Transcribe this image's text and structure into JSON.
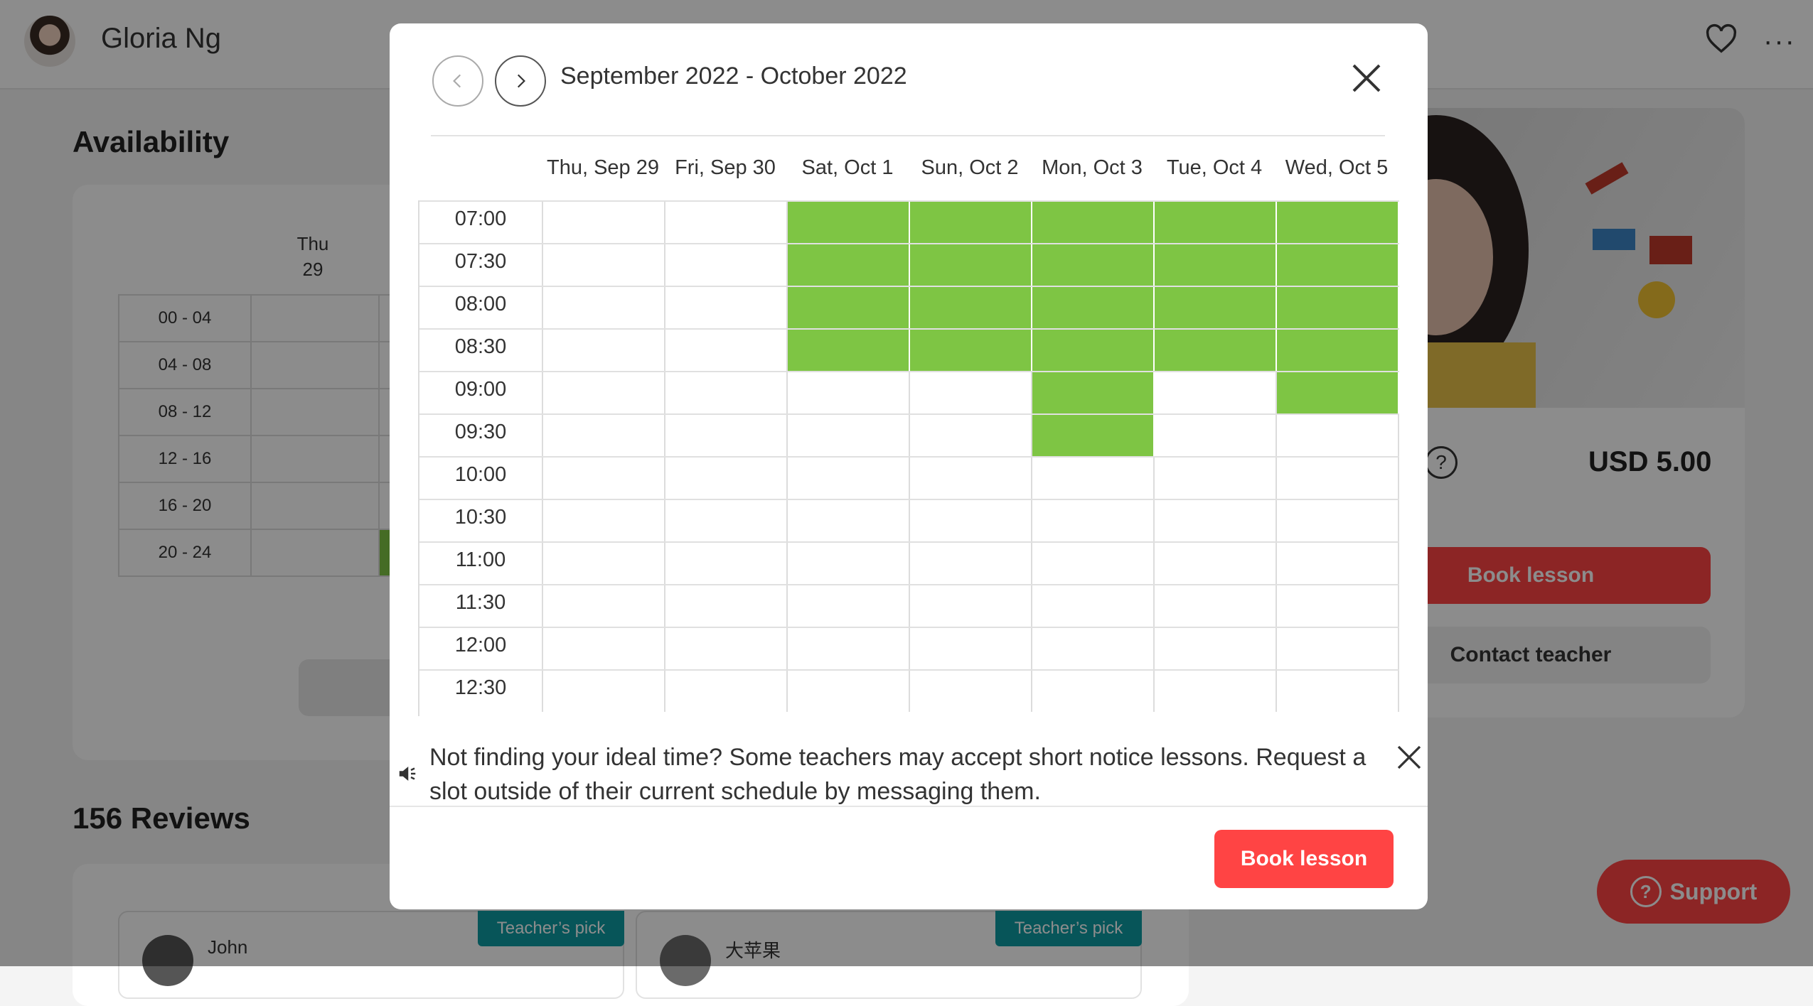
{
  "header": {
    "teacher_name": "Gloria Ng"
  },
  "availability": {
    "title": "Availability",
    "day_name": "Thu",
    "day_num": "29",
    "rows": [
      "00 - 04",
      "04 - 08",
      "08 - 12",
      "12 - 16",
      "16 - 20",
      "20 - 24"
    ]
  },
  "reviews": {
    "title": "156 Reviews",
    "items": [
      {
        "badge": "Teacher’s pick",
        "name": "John"
      },
      {
        "badge": "Teacher’s pick",
        "name": "大苹果"
      }
    ]
  },
  "side": {
    "price": "USD 5.00",
    "book_label": "Book lesson",
    "contact_label": "Contact teacher"
  },
  "support": {
    "label": "Support"
  },
  "modal": {
    "range": "September 2022 - October 2022",
    "days": [
      "Thu, Sep 29",
      "Fri, Sep 30",
      "Sat, Oct 1",
      "Sun, Oct 2",
      "Mon, Oct 3",
      "Tue, Oct 4",
      "Wed, Oct 5"
    ],
    "times": [
      "07:00",
      "07:30",
      "08:00",
      "08:30",
      "09:00",
      "09:30",
      "10:00",
      "10:30",
      "11:00",
      "11:30",
      "12:00",
      "12:30"
    ],
    "available": {
      "07:00": [
        2,
        3,
        4,
        5,
        6
      ],
      "07:30": [
        2,
        3,
        4,
        5,
        6
      ],
      "08:00": [
        2,
        3,
        4,
        5,
        6
      ],
      "08:30": [
        2,
        3,
        4,
        5,
        6
      ],
      "09:00": [
        4,
        6
      ],
      "09:30": [
        4
      ]
    },
    "notice": "Not finding your ideal time? Some teachers may accept short notice lessons. Request a slot outside of their current schedule by messaging them.",
    "book_label": "Book lesson"
  },
  "colors": {
    "available": "#7ec544",
    "brand": "#ff4444",
    "badge": "#0e9ca3"
  }
}
